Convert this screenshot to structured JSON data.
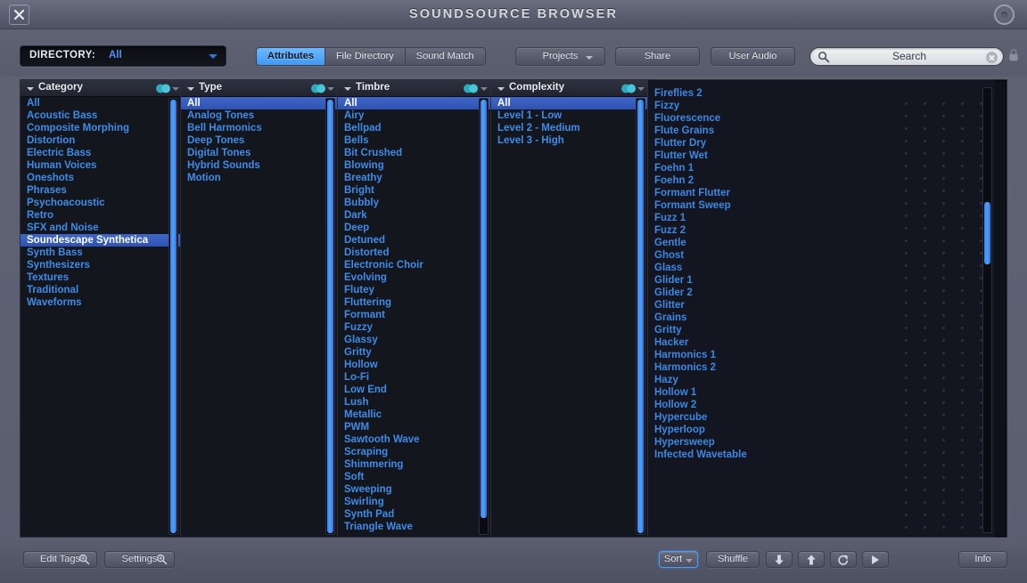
{
  "window": {
    "title": "SOUNDSOURCE BROWSER",
    "close_icon": "close-x-icon",
    "record_icon": "record-circle-icon"
  },
  "toolbar": {
    "directory_label": "DIRECTORY:",
    "directory_value": "All",
    "tabs": [
      {
        "label": "Attributes",
        "active": true
      },
      {
        "label": "File Directory",
        "active": false
      },
      {
        "label": "Sound Match",
        "active": false
      }
    ],
    "projects_label": "Projects",
    "share_label": "Share",
    "user_audio_label": "User Audio",
    "search_placeholder": "Search",
    "search_value": "",
    "search_icon": "magnifier-icon",
    "clear_icon": "clear-circle-icon",
    "lock_icon": "lock-icon"
  },
  "columns": {
    "category": {
      "title": "Category",
      "selected": "Soundescape Synthetica",
      "items": [
        "All",
        "Acoustic Bass",
        "Composite Morphing",
        "Distortion",
        "Electric Bass",
        "Human Voices",
        "Oneshots",
        "Phrases",
        "Psychoacoustic",
        "Retro",
        "SFX and Noise",
        "Soundescape Synthetica",
        "Synth Bass",
        "Synthesizers",
        "Textures",
        "Traditional",
        "Waveforms"
      ]
    },
    "type": {
      "title": "Type",
      "selected": "All",
      "items": [
        "All",
        "Analog Tones",
        "Bell Harmonics",
        "Deep Tones",
        "Digital Tones",
        "Hybrid Sounds",
        "Motion"
      ]
    },
    "timbre": {
      "title": "Timbre",
      "selected": "All",
      "items": [
        "All",
        "Airy",
        "Bellpad",
        "Bells",
        "Bit Crushed",
        "Blowing",
        "Breathy",
        "Bright",
        "Bubbly",
        "Dark",
        "Deep",
        "Detuned",
        "Distorted",
        "Electronic Choir",
        "Evolving",
        "Flutey",
        "Fluttering",
        "Formant",
        "Fuzzy",
        "Glassy",
        "Gritty",
        "Hollow",
        "Lo-Fi",
        "Low End",
        "Lush",
        "Metallic",
        "PWM",
        "Sawtooth Wave",
        "Scraping",
        "Shimmering",
        "Soft",
        "Sweeping",
        "Swirling",
        "Synth Pad",
        "Triangle Wave"
      ]
    },
    "complexity": {
      "title": "Complexity",
      "selected": "All",
      "items": [
        "All",
        "Level 1 - Low",
        "Level 2 - Medium",
        "Level 3 - High"
      ]
    }
  },
  "results": {
    "items": [
      "Fireflies 2",
      "Fizzy",
      "Fluorescence",
      "Flute Grains",
      "Flutter Dry",
      "Flutter Wet",
      "Foehn 1",
      "Foehn 2",
      "Formant Flutter",
      "Formant Sweep",
      "Fuzz 1",
      "Fuzz 2",
      "Gentle",
      "Ghost",
      "Glass",
      "Glider 1",
      "Glider 2",
      "Glitter",
      "Grains",
      "Gritty",
      "Hacker",
      "Harmonics 1",
      "Harmonics 2",
      "Hazy",
      "Hollow 1",
      "Hollow 2",
      "Hypercube",
      "Hyperloop",
      "Hypersweep",
      "Infected Wavetable"
    ]
  },
  "bottom": {
    "edit_tags_label": "Edit Tags",
    "settings_label": "Settings",
    "sort_label": "Sort",
    "shuffle_label": "Shuffle",
    "info_label": "Info",
    "down_icon": "arrow-down-icon",
    "up_icon": "arrow-up-icon",
    "reload_icon": "reload-icon",
    "play_icon": "play-icon",
    "magnifier_icon": "magnifier-icon"
  },
  "colors": {
    "accent_blue": "#3a95f4",
    "list_text": "#3e8ce8",
    "selection": "#3f67c8",
    "panel_bg": "#14161e",
    "chrome": "#5a5e6f",
    "header_teal": "#34b6c8"
  }
}
